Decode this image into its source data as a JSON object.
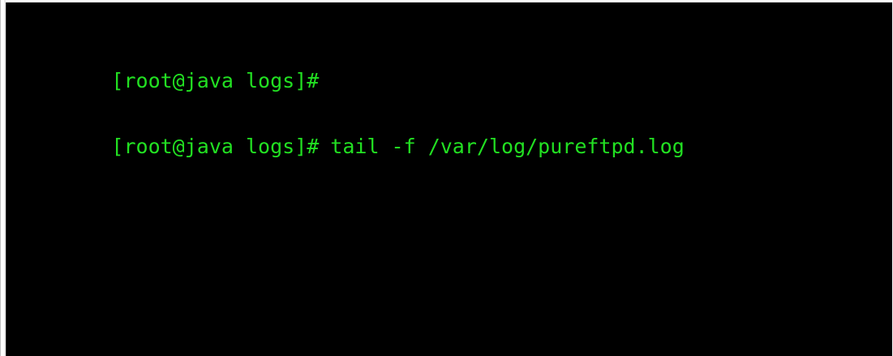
{
  "terminal": {
    "lines": [
      {
        "prompt": "[root@java logs]#",
        "command": ""
      },
      {
        "prompt": "[root@java logs]#",
        "command": "tail -f /var/log/pureftpd.log"
      }
    ],
    "colors": {
      "background": "#000000",
      "text": "#22e022"
    }
  }
}
